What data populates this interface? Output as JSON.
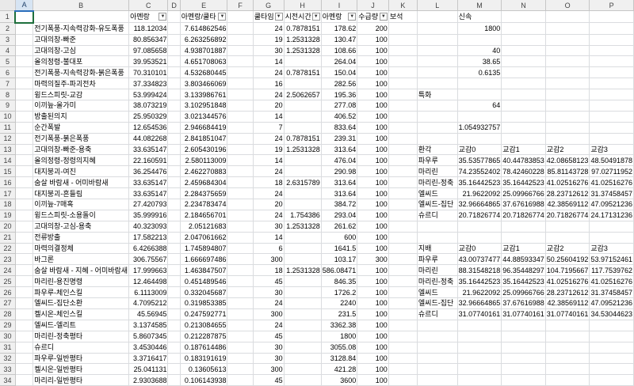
{
  "columns": [
    "A",
    "B",
    "C",
    "D",
    "E",
    "F",
    "G",
    "H",
    "I",
    "J",
    "K",
    "L",
    "M",
    "N",
    "O",
    "P"
  ],
  "rows": [
    {
      "n": "1",
      "c": [
        "",
        "",
        "아멘랑",
        "",
        "아멘랑/쿨타",
        "",
        "쿨타임",
        "시전시간",
        "아멘랑",
        "수급량",
        "보석",
        "",
        "신속",
        "",
        "",
        ""
      ]
    },
    {
      "n": "2",
      "c": [
        "",
        "전기폭풍-지속력강화-유도폭풍",
        "118.12034",
        "",
        "7.614862546",
        "",
        "24",
        "0.7878151",
        "178.62",
        "200",
        "",
        "",
        "1800",
        "",
        "",
        ""
      ]
    },
    {
      "n": "3",
      "c": [
        "",
        "고대의창-빠준",
        "80.856347",
        "",
        "6.263256892",
        "",
        "19",
        "1.2531328",
        "130.47",
        "100",
        "",
        "",
        "",
        "",
        "",
        ""
      ]
    },
    {
      "n": "4",
      "c": [
        "",
        "고대의창-고심",
        "97.085658",
        "",
        "4.938701887",
        "",
        "30",
        "1.2531328",
        "108.66",
        "100",
        "",
        "",
        "40",
        "",
        "",
        ""
      ]
    },
    {
      "n": "5",
      "c": [
        "",
        "올의정령-불대포",
        "39.953521",
        "",
        "4.651708063",
        "",
        "14",
        "",
        "264.04",
        "100",
        "",
        "",
        "38.65",
        "",
        "",
        ""
      ]
    },
    {
      "n": "6",
      "c": [
        "",
        "전기폭풍-지속력강화-붉은폭풍",
        "70.310101",
        "",
        "4.532680445",
        "",
        "24",
        "0.7878151",
        "150.04",
        "100",
        "",
        "",
        "0.6135",
        "",
        "",
        ""
      ]
    },
    {
      "n": "7",
      "c": [
        "",
        "마력의질주-파괴전차",
        "37.334823",
        "",
        "3.803466069",
        "",
        "16",
        "",
        "282.56",
        "100",
        "",
        "",
        "",
        "",
        "",
        ""
      ]
    },
    {
      "n": "8",
      "c": [
        "",
        "윙드스피릿-교감",
        "53.999424",
        "",
        "3.133986761",
        "",
        "24",
        "2.5062657",
        "195.36",
        "100",
        "",
        "특화",
        "",
        "",
        "",
        ""
      ]
    },
    {
      "n": "9",
      "c": [
        "",
        "이끼늪-올가미",
        "38.073219",
        "",
        "3.102951848",
        "",
        "20",
        "",
        "277.08",
        "100",
        "",
        "",
        "64",
        "",
        "",
        ""
      ]
    },
    {
      "n": "10",
      "c": [
        "",
        "방출된의지",
        "25.950329",
        "",
        "3.021344576",
        "",
        "14",
        "",
        "406.52",
        "100",
        "",
        "",
        "",
        "",
        "",
        ""
      ]
    },
    {
      "n": "11",
      "c": [
        "",
        "순간폭발",
        "12.654536",
        "",
        "2.946684419",
        "",
        "7",
        "",
        "833.64",
        "100",
        "",
        "",
        "1.054932757",
        "",
        "",
        ""
      ]
    },
    {
      "n": "12",
      "c": [
        "",
        "전기폭풍-붉은폭풍",
        "44.082268",
        "",
        "2.841851047",
        "",
        "24",
        "0.7878151",
        "239.31",
        "100",
        "",
        "",
        "",
        "",
        "",
        ""
      ]
    },
    {
      "n": "13",
      "c": [
        "",
        "고대의창-빠준-용축",
        "33.635147",
        "",
        "2.605430196",
        "",
        "19",
        "1.2531328",
        "313.64",
        "100",
        "",
        "환각",
        "교감0",
        "교감1",
        "교감2",
        "교감3"
      ]
    },
    {
      "n": "14",
      "c": [
        "",
        "올의정령-정령의지혜",
        "22.160591",
        "",
        "2.580113009",
        "",
        "14",
        "",
        "476.04",
        "100",
        "",
        "파우루",
        "35.53577865",
        "40.44783853",
        "42.08658123",
        "48.50491878"
      ]
    },
    {
      "n": "15",
      "c": [
        "",
        "대지붕괴-여진",
        "36.254476",
        "",
        "2.462270883",
        "",
        "24",
        "",
        "290.98",
        "100",
        "",
        "마리린",
        "74.23552402",
        "78.42460228",
        "85.81143728",
        "97.02711952"
      ]
    },
    {
      "n": "16",
      "c": [
        "",
        "숨살 바람새 - 어미바람새",
        "33.635147",
        "",
        "2.459684304",
        "",
        "18",
        "2.6315789",
        "313.64",
        "100",
        "",
        "마리린-정축",
        "35.16442523",
        "35.16442523",
        "41.02516276",
        "41.02516276"
      ]
    },
    {
      "n": "17",
      "c": [
        "",
        "대지붕괴-흔들림",
        "33.635147",
        "",
        "2.284375659",
        "",
        "24",
        "",
        "313.64",
        "100",
        "",
        "엘씨드",
        "21.9622092",
        "25.09966766",
        "28.23712612",
        "31.37458457"
      ]
    },
    {
      "n": "18",
      "c": [
        "",
        "이끼늪-7매혹",
        "27.420793",
        "",
        "2.234783474",
        "",
        "20",
        "",
        "384.72",
        "100",
        "",
        "엘씨드-집단",
        "32.96664865",
        "37.67616988",
        "42.38569112",
        "47.09521236"
      ]
    },
    {
      "n": "19",
      "c": [
        "",
        "윙드스피릿-소용돌이",
        "35.999916",
        "",
        "2.184656701",
        "",
        "24",
        "1.754386",
        "293.04",
        "100",
        "",
        "슈르디",
        "20.71826774",
        "20.71826774",
        "20.71826774",
        "24.17131236"
      ]
    },
    {
      "n": "20",
      "c": [
        "",
        "고대의창-고심-용축",
        "40.323093",
        "",
        "2.05121683",
        "",
        "30",
        "1.2531328",
        "261.62",
        "100",
        "",
        "",
        "",
        "",
        "",
        ""
      ]
    },
    {
      "n": "21",
      "c": [
        "",
        "전류방출",
        "17.582213",
        "",
        "2.047061662",
        "",
        "14",
        "",
        "600",
        "100",
        "",
        "",
        "",
        "",
        "",
        ""
      ]
    },
    {
      "n": "22",
      "c": [
        "",
        "마력의결정체",
        "6.4266388",
        "",
        "1.745894807",
        "",
        "6",
        "",
        "1641.5",
        "100",
        "",
        "지배",
        "교감0",
        "교감1",
        "교감2",
        "교감3"
      ]
    },
    {
      "n": "23",
      "c": [
        "",
        "바그론",
        "306.75567",
        "",
        "1.666697486",
        "",
        "300",
        "",
        "103.17",
        "300",
        "",
        "파우루",
        "43.00737477",
        "44.88593347",
        "50.25604192",
        "53.97152461"
      ]
    },
    {
      "n": "24",
      "c": [
        "",
        "숨살 바람새 - 지혜 - 어미바람새",
        "17.999663",
        "",
        "1.463847507",
        "",
        "18",
        "1.2531328",
        "586.08471",
        "100",
        "",
        "마리린",
        "88.31548218",
        "96.35448297",
        "104.7195667",
        "117.7539762"
      ]
    },
    {
      "n": "25",
      "c": [
        "",
        "마리린-용진명령",
        "12.464498",
        "",
        "0.451489546",
        "",
        "45",
        "",
        "846.35",
        "100",
        "",
        "마리린-정축",
        "35.16442523",
        "35.16442523",
        "41.02516276",
        "41.02516276"
      ]
    },
    {
      "n": "26",
      "c": [
        "",
        "파우루-체인스킬",
        "6.1113009",
        "",
        "0.332045687",
        "",
        "30",
        "",
        "1726.2",
        "100",
        "",
        "엘씨드",
        "21.9622092",
        "25.09966766",
        "28.23712612",
        "31.37458457"
      ]
    },
    {
      "n": "27",
      "c": [
        "",
        "엘씨드-집단소환",
        "4.7095212",
        "",
        "0.319853385",
        "",
        "24",
        "",
        "2240",
        "100",
        "",
        "엘씨드-집단",
        "32.96664865",
        "37.67616988",
        "42.38569112",
        "47.09521236"
      ]
    },
    {
      "n": "28",
      "c": [
        "",
        "켈시온-체인스킬",
        "45.56945",
        "",
        "0.247592771",
        "",
        "300",
        "",
        "231.5",
        "100",
        "",
        "슈르디",
        "31.07740161",
        "31.07740161",
        "31.07740161",
        "34.53044623"
      ]
    },
    {
      "n": "29",
      "c": [
        "",
        "엘씨드-엘리트",
        "3.1374585",
        "",
        "0.213084655",
        "",
        "24",
        "",
        "3362.38",
        "100",
        "",
        "",
        "",
        "",
        "",
        ""
      ]
    },
    {
      "n": "30",
      "c": [
        "",
        "마리린-정축평타",
        "5.8607345",
        "",
        "0.212287875",
        "",
        "45",
        "",
        "1800",
        "100",
        "",
        "",
        "",
        "",
        "",
        ""
      ]
    },
    {
      "n": "31",
      "c": [
        "",
        "슈르디",
        "3.4530446",
        "",
        "0.187614486",
        "",
        "30",
        "",
        "3055.08",
        "100",
        "",
        "",
        "",
        "",
        "",
        ""
      ]
    },
    {
      "n": "32",
      "c": [
        "",
        "파우루-일반평타",
        "3.3716417",
        "",
        "0.183191619",
        "",
        "30",
        "",
        "3128.84",
        "100",
        "",
        "",
        "",
        "",
        "",
        ""
      ]
    },
    {
      "n": "33",
      "c": [
        "",
        "켈시온-일반평타",
        "25.041131",
        "",
        "0.13605613",
        "",
        "300",
        "",
        "421.28",
        "100",
        "",
        "",
        "",
        "",
        "",
        ""
      ]
    },
    {
      "n": "34",
      "c": [
        "",
        "마리리-일반평타",
        "2.9303688",
        "",
        "0.106143938",
        "",
        "45",
        "",
        "3600",
        "100",
        "",
        "",
        "",
        "",
        "",
        ""
      ]
    }
  ],
  "filter_columns": [
    "C",
    "E",
    "G",
    "H",
    "I",
    "J"
  ],
  "header_filter_icon": "dropdown-arrow-icon",
  "selected_cell": "A1"
}
